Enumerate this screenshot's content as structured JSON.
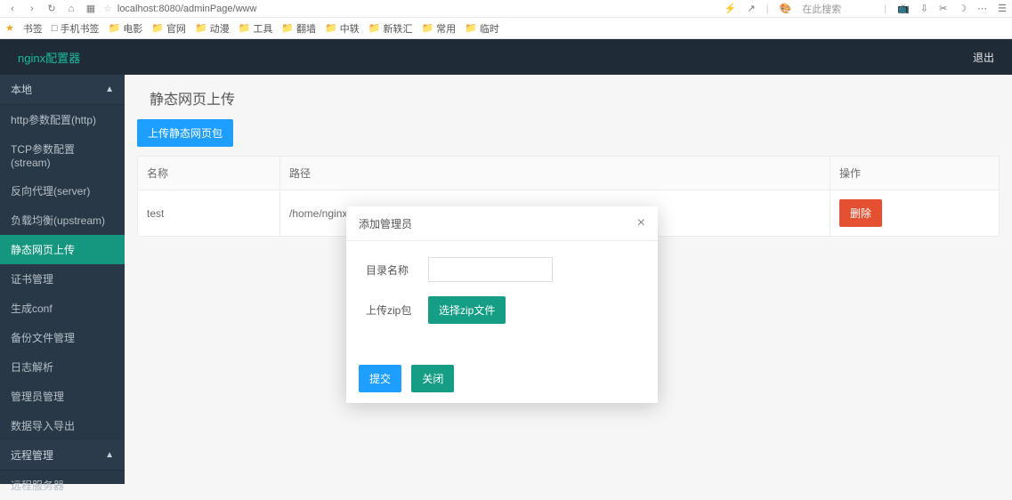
{
  "browser": {
    "url": "localhost:8080/adminPage/www",
    "search_placeholder": "在此搜索"
  },
  "bookmarks": {
    "root": "书签",
    "mobile": "手机书签",
    "folders": [
      "电影",
      "官网",
      "动漫",
      "工具",
      "翻墙",
      "中轶",
      "新轶汇",
      "常用",
      "临时"
    ]
  },
  "header": {
    "brand": "nginx配置器",
    "logout": "退出"
  },
  "sidebar": {
    "group1": "本地",
    "items1": [
      "http参数配置(http)",
      "TCP参数配置(stream)",
      "反向代理(server)",
      "负载均衡(upstream)",
      "静态网页上传",
      "证书管理",
      "生成conf",
      "备份文件管理",
      "日志解析",
      "管理员管理",
      "数据导入导出"
    ],
    "active_index": 4,
    "group2": "远程管理",
    "items2": [
      "远程服务器"
    ]
  },
  "page": {
    "title": "静态网页上传",
    "upload_btn": "上传静态网页包",
    "table": {
      "headers": [
        "名称",
        "路径",
        "操作"
      ],
      "rows": [
        {
          "name": "test",
          "path": "/home/nginxWebUI/wwww/test",
          "op_label": "删除"
        }
      ]
    }
  },
  "modal": {
    "title": "添加管理员",
    "close": "×",
    "dir_label": "目录名称",
    "zip_label": "上传zip包",
    "zip_btn": "选择zip文件",
    "submit": "提交",
    "cancel": "关闭"
  }
}
